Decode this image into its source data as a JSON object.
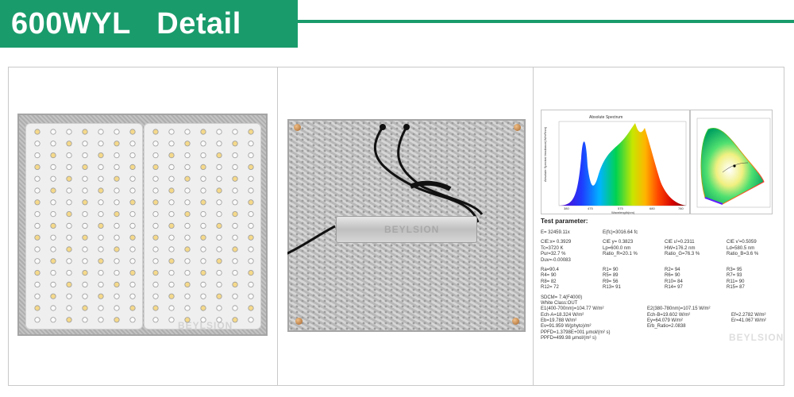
{
  "header": {
    "title": "600WYL   Detail"
  },
  "colors": {
    "accent": "#1a9b6c",
    "panel_border": "#c9c9c9"
  },
  "watermark": {
    "text": "BEYLSION"
  },
  "spectrum": {
    "title": "Absolute Spectrum",
    "ylabel": "Absolute Spectral Irradiance(W/m²/nm)",
    "xlabel": "Wavelength(nm)",
    "x_ticks": [
      "380",
      "475",
      "575",
      "680",
      "780"
    ]
  },
  "params": {
    "title": "Test parameter:",
    "rows": [
      [
        "E=  32459.11x",
        "E(fc)=3016.64 fc",
        "",
        ""
      ],
      [
        "CIE:x= 0.3929",
        "CIE y= 0.3823",
        "CIE u'=0.2311",
        "CIE v'=0.5059"
      ],
      [
        "Tc=3720 K",
        "Lp=600.0 nm",
        "HW=176.2 nm",
        "Ld=580.5 nm"
      ],
      [
        "Pur=32.7 %",
        "Ratio_R=20.1 %",
        "Ratio_G=76.3 %",
        "Ratio_B=3.6 %"
      ],
      [
        "Duv=-0.00083",
        "",
        "",
        ""
      ]
    ],
    "ra_rows": [
      [
        "Ra=90.4",
        "R1= 90",
        "R2= 94",
        "R3= 95"
      ],
      [
        "R4= 90",
        "R5= 89",
        "R6= 90",
        "R7= 93"
      ],
      [
        "R8= 82",
        "R9= 56",
        "R10= 84",
        "R11= 90"
      ],
      [
        "R12= 72",
        "R13= 91",
        "R14= 97",
        "R15= 87"
      ]
    ],
    "sdcm": "SDCM= 7.4(F4000)",
    "white_class": "White Class:OUT",
    "e_rows": [
      [
        "E1(400-700nm)=104.77 W/m²",
        "",
        "E2(380-780nm)=107.15 W/m²"
      ],
      [
        "Ech-A=18.324 W/m²",
        "Ech-B=19.602 W/m²",
        "Ef=2.2782 W/m²"
      ],
      [
        "Eb=19.788 W/m²",
        "Ey=64.079 W/m²",
        "Er=41.067 W/m²"
      ],
      [
        "Ev=91.959 W(phyto)/m²",
        "Erb_Ratio=2.0838",
        ""
      ],
      [
        "PPFD=1.3798E+001 μmol/(m² s)",
        "",
        ""
      ],
      [
        "PPFD=499.98 μmol/(m² s)",
        "",
        ""
      ]
    ]
  }
}
